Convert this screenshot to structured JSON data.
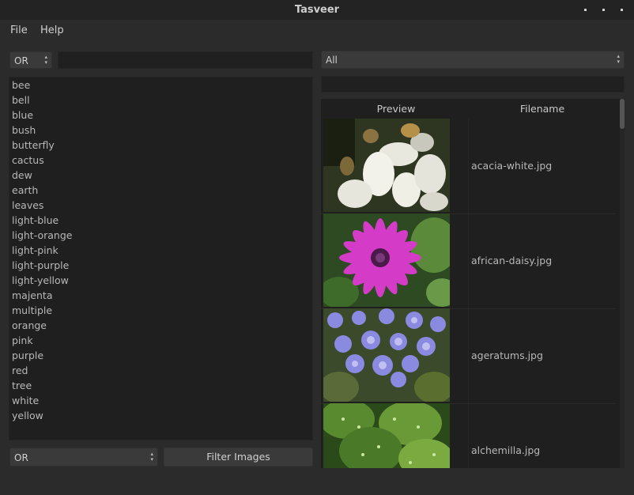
{
  "window": {
    "title": "Tasveer"
  },
  "menu": {
    "file": "File",
    "help": "Help"
  },
  "top_search": {
    "operator": "OR",
    "query": ""
  },
  "category_filter": {
    "selected": "All",
    "path": ""
  },
  "tags": [
    "bee",
    "bell",
    "blue",
    "bush",
    "butterfly",
    "cactus",
    "dew",
    "earth",
    "leaves",
    "light-blue",
    "light-orange",
    "light-pink",
    "light-purple",
    "light-yellow",
    "majenta",
    "multiple",
    "orange",
    "pink",
    "purple",
    "red",
    "tree",
    "white",
    "yellow"
  ],
  "bottom_filter": {
    "operator": "OR",
    "button_label": "Filter Images"
  },
  "table": {
    "columns": {
      "preview": "Preview",
      "filename": "Filename"
    },
    "rows": [
      {
        "filename": "acacia-white.jpg",
        "image": "white-flowers"
      },
      {
        "filename": "african-daisy.jpg",
        "image": "purple-daisy"
      },
      {
        "filename": "ageratums.jpg",
        "image": "blue-ageratum"
      },
      {
        "filename": "alchemilla.jpg",
        "image": "green-leaves-dew"
      }
    ]
  }
}
